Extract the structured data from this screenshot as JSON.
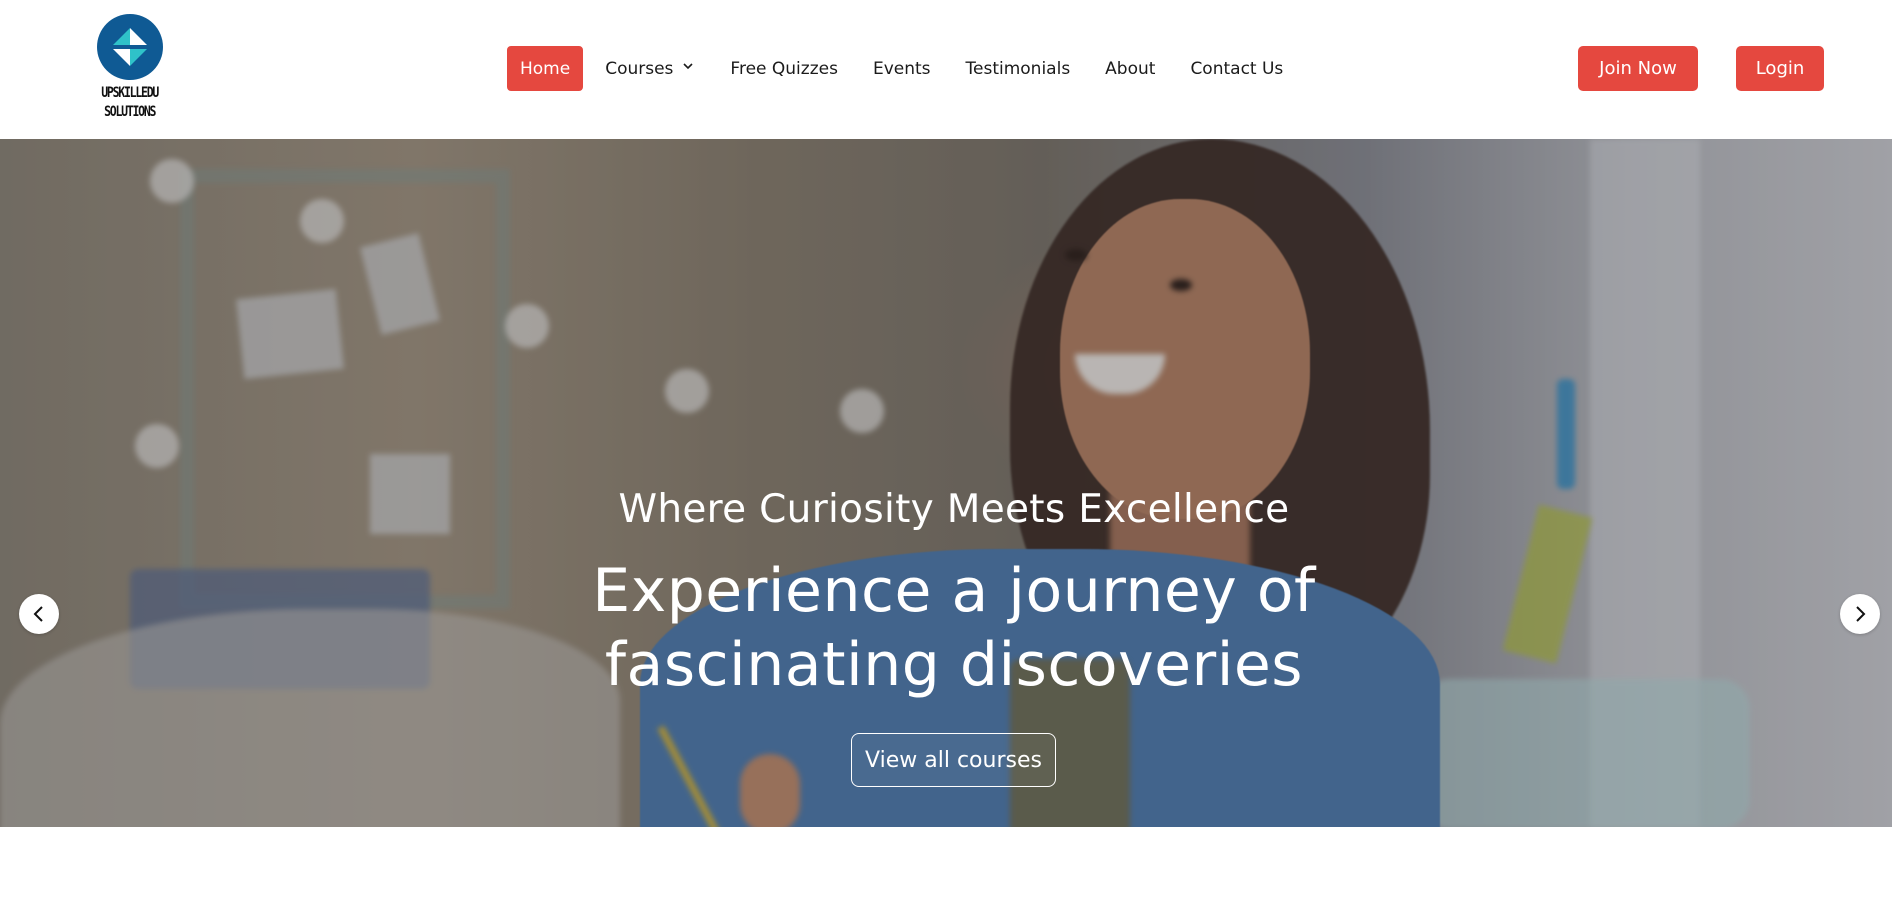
{
  "logo": {
    "line1": "UPSKILLEDU",
    "line2": "SOLUTIONS",
    "mark_color": "#0f5a94",
    "accent_color": "#2fc2c9"
  },
  "nav": {
    "items": [
      {
        "label": "Home",
        "active": true
      },
      {
        "label": "Courses",
        "has_dropdown": true
      },
      {
        "label": "Free Quizzes"
      },
      {
        "label": "Events"
      },
      {
        "label": "Testimonials"
      },
      {
        "label": "About"
      },
      {
        "label": "Contact Us"
      }
    ],
    "active_color": "#e5483f"
  },
  "header_actions": {
    "join_label": "Join Now",
    "login_label": "Login",
    "button_color": "#e5483f"
  },
  "hero": {
    "tagline": "Where Curiosity Meets Excellence",
    "title_line1": "Experience a journey of",
    "title_line2": "fascinating discoveries",
    "cta_label": "View all courses",
    "prev_icon": "chevron-left-icon",
    "next_icon": "chevron-right-icon"
  }
}
